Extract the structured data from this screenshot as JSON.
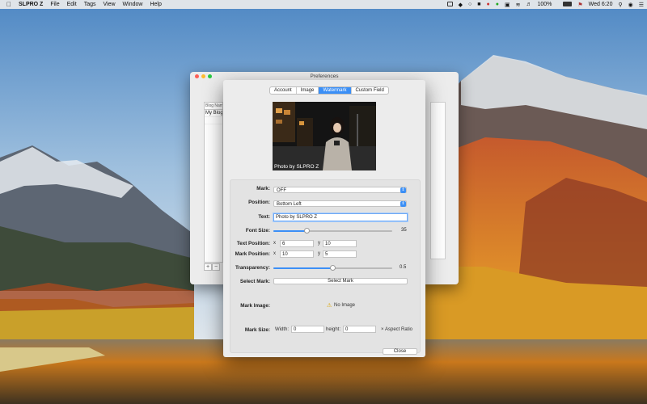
{
  "menubar": {
    "app_name": "SLPRO Z",
    "items": [
      "File",
      "Edit",
      "Tags",
      "View",
      "Window",
      "Help"
    ],
    "battery": "100%",
    "day_time": "Wed 6:20"
  },
  "background_window": {
    "title": "Preferences",
    "list_header": "Blog Name",
    "list_items": [
      "My Blog"
    ],
    "add_label": "+",
    "remove_label": "−"
  },
  "preferences": {
    "tabs": [
      {
        "label": "Account",
        "active": false
      },
      {
        "label": "Image",
        "active": false
      },
      {
        "label": "Watermark",
        "active": true
      },
      {
        "label": "Custom Field",
        "active": false
      }
    ],
    "preview_caption": "Photo by SLPRO Z",
    "mark": {
      "label": "Mark:",
      "value": "OFF"
    },
    "position": {
      "label": "Position:",
      "value": "Bottom Left"
    },
    "text": {
      "label": "Text:",
      "value": "Photo by SLPRO Z"
    },
    "font_size": {
      "label": "Font Size:",
      "value": "35",
      "fraction": 0.28
    },
    "text_position": {
      "label": "Text Position:",
      "x_label": "x",
      "x": "6",
      "y_label": "y",
      "y": "10"
    },
    "mark_position": {
      "label": "Mark Position:",
      "x_label": "x",
      "x": "10",
      "y_label": "y",
      "y": "5"
    },
    "transparency": {
      "label": "Transparency:",
      "value": "0.5",
      "fraction": 0.5
    },
    "select_mark": {
      "label": "Select Mark:",
      "button": "Select Mark"
    },
    "mark_image": {
      "label": "Mark Image:",
      "status": "No Image"
    },
    "mark_size": {
      "label": "Mark Size:",
      "width_label": "Width:",
      "width": "0",
      "height_label": "height:",
      "height": "0",
      "aspect_label": "Aspect Ratio"
    },
    "close_button": "Close"
  },
  "colors": {
    "accent": "#3b8ff6"
  }
}
